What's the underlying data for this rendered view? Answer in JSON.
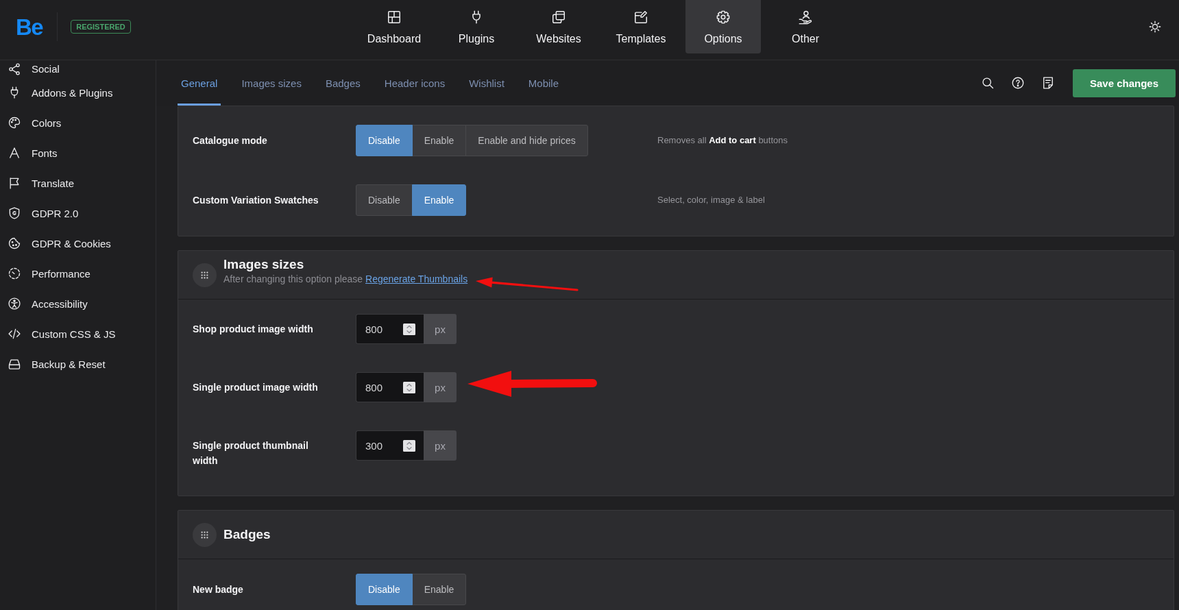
{
  "topbar": {
    "logo": "Be",
    "badge": "REGISTERED",
    "nav": [
      {
        "label": "Dashboard",
        "selected": false
      },
      {
        "label": "Plugins",
        "selected": false
      },
      {
        "label": "Websites",
        "selected": false
      },
      {
        "label": "Templates",
        "selected": false
      },
      {
        "label": "Options",
        "selected": true
      },
      {
        "label": "Other",
        "selected": false
      }
    ]
  },
  "sidebar": {
    "items": [
      {
        "label": "Social",
        "selected": false
      },
      {
        "label": "Addons & Plugins",
        "selected": false
      },
      {
        "label": "Colors",
        "selected": false
      },
      {
        "label": "Fonts",
        "selected": false
      },
      {
        "label": "Translate",
        "selected": false
      },
      {
        "label": "GDPR 2.0",
        "selected": false
      },
      {
        "label": "GDPR & Cookies",
        "selected": false
      },
      {
        "label": "Performance",
        "selected": false
      },
      {
        "label": "Accessibility",
        "selected": false
      },
      {
        "label": "Custom CSS & JS",
        "selected": false
      },
      {
        "label": "Backup & Reset",
        "selected": false
      }
    ]
  },
  "tabs": [
    {
      "label": "General",
      "selected": true
    },
    {
      "label": "Images sizes",
      "selected": false
    },
    {
      "label": "Badges",
      "selected": false
    },
    {
      "label": "Header icons",
      "selected": false
    },
    {
      "label": "Wishlist",
      "selected": false
    },
    {
      "label": "Mobile",
      "selected": false
    }
  ],
  "toolbar": {
    "save_button": "Save changes"
  },
  "sections": [
    {
      "rows": [
        {
          "kind": "segmented",
          "label": "Catalogue mode",
          "options": [
            {
              "label": "Disable",
              "selected": true
            },
            {
              "label": "Enable",
              "selected": false
            },
            {
              "label": "Enable and hide prices",
              "selected": false
            }
          ],
          "description": "Removes all **Add to cart** buttons"
        },
        {
          "kind": "segmented",
          "label": "Custom Variation Swatches",
          "options": [
            {
              "label": "Disable",
              "selected": false
            },
            {
              "label": "Enable",
              "selected": true
            }
          ],
          "description": "Select, color, image & label"
        }
      ]
    },
    {
      "title": "Images sizes",
      "subtitle": "After changing this option please",
      "link": {
        "label": "Regenerate Thumbnails",
        "arrow": true
      },
      "rows": [
        {
          "kind": "number",
          "label": "Shop product image width",
          "value": "800",
          "unit": "px",
          "arrow": false
        },
        {
          "kind": "number",
          "label": "Single product image width",
          "value": "800",
          "unit": "px",
          "arrow": true
        },
        {
          "kind": "number",
          "label": "Single product thumbnail width",
          "value": "300",
          "unit": "px",
          "arrow": false
        }
      ]
    },
    {
      "title": "Badges",
      "rows": [
        {
          "kind": "segmented",
          "label": "New badge",
          "options": [
            {
              "label": "Disable",
              "selected": true
            },
            {
              "label": "Enable",
              "selected": false
            }
          ]
        }
      ]
    }
  ]
}
